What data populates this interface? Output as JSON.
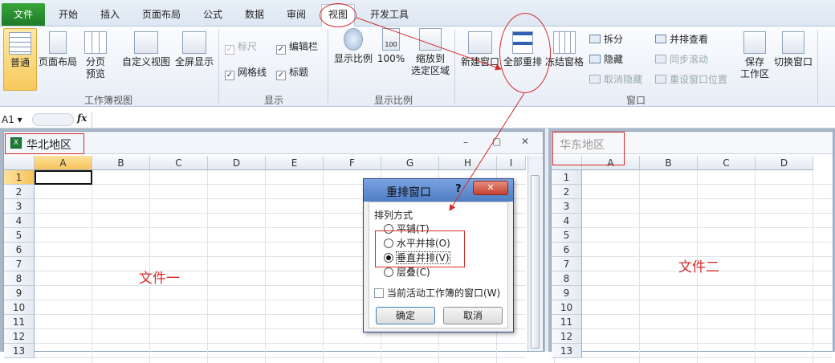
{
  "tabs": [
    "文件",
    "开始",
    "插入",
    "页面布局",
    "公式",
    "数据",
    "审阅",
    "视图",
    "开发工具"
  ],
  "ribbon": {
    "workbook_views": {
      "group": "工作簿视图",
      "normal": "普通",
      "page_layout": "页面布局",
      "page_break": "分页",
      "page_break2": "预览",
      "custom": "自定义视图",
      "fullscreen": "全屏显示"
    },
    "show": {
      "group": "显示",
      "ruler": "标尺",
      "edit_bar": "编辑栏",
      "gridlines": "网格线",
      "headings": "标题"
    },
    "zoom": {
      "group": "显示比例",
      "zoom": "显示比例",
      "z100": "100%",
      "zoom_sel": "缩放到",
      "zoom_sel2": "选定区域",
      "icon_label": "100"
    },
    "window": {
      "group": "窗口",
      "new": "新建窗口",
      "arrange": "全部重排",
      "freeze": "冻结窗格",
      "split": "拆分",
      "hide": "隐藏",
      "unhide": "取消隐藏",
      "side": "并排查看",
      "sync": "同步滚动",
      "reset": "重设窗口位置",
      "save_ws": "保存",
      "save_ws2": "工作区",
      "switch": "切换窗口"
    }
  },
  "formula_bar": {
    "cell_ref": "A1",
    "fx": "fx"
  },
  "left_window": {
    "title": "华北地区",
    "ctrl_min": "–",
    "ctrl_max": "▢",
    "ctrl_close": "✕",
    "cols": [
      "A",
      "B",
      "C",
      "D",
      "E",
      "F",
      "G",
      "H",
      "I"
    ],
    "rows": [
      "1",
      "2",
      "3",
      "4",
      "5",
      "6",
      "7",
      "8",
      "9",
      "10",
      "11",
      "12",
      "13"
    ],
    "label": "文件一"
  },
  "right_window": {
    "title": "华东地区",
    "cols": [
      "A",
      "B",
      "C",
      "D"
    ],
    "rows": [
      "1",
      "2",
      "3",
      "4",
      "5",
      "6",
      "7",
      "8",
      "9",
      "10",
      "11",
      "12",
      "13"
    ],
    "label": "文件二"
  },
  "dialog": {
    "title": "重排窗口",
    "help": "?",
    "close": "✕",
    "section": "排列方式",
    "options": [
      "平铺(T)",
      "水平并排(O)",
      "垂直并排(V)",
      "层叠(C)"
    ],
    "selected": 2,
    "checkbox": "当前活动工作簿的窗口(W)",
    "ok": "确定",
    "cancel": "取消"
  },
  "colors": {
    "accent": "#d42a2a",
    "file_tab": "#2a8a32",
    "dialog_title": "#4e7dc4"
  }
}
